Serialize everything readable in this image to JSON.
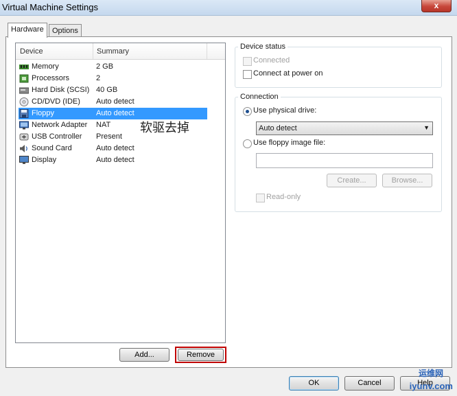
{
  "window": {
    "title": "Virtual Machine Settings",
    "close_glyph": "x"
  },
  "tabs": [
    {
      "label": "Hardware"
    },
    {
      "label": "Options"
    }
  ],
  "device_list": {
    "col_device": "Device",
    "col_summary": "Summary",
    "rows": [
      {
        "name": "Memory",
        "summary": "2 GB",
        "icon": "memory-icon"
      },
      {
        "name": "Processors",
        "summary": "2",
        "icon": "processor-icon"
      },
      {
        "name": "Hard Disk (SCSI)",
        "summary": "40 GB",
        "icon": "hard-disk-icon"
      },
      {
        "name": "CD/DVD (IDE)",
        "summary": "Auto detect",
        "icon": "cd-dvd-icon"
      },
      {
        "name": "Floppy",
        "summary": "Auto detect",
        "icon": "floppy-icon"
      },
      {
        "name": "Network Adapter",
        "summary": "NAT",
        "icon": "network-adapter-icon"
      },
      {
        "name": "USB Controller",
        "summary": "Present",
        "icon": "usb-icon"
      },
      {
        "name": "Sound Card",
        "summary": "Auto detect",
        "icon": "speaker-icon"
      },
      {
        "name": "Display",
        "summary": "Auto detect",
        "icon": "display-icon"
      }
    ],
    "selected_index": 4
  },
  "annotation": "软驱去掉",
  "buttons": {
    "add": "Add...",
    "remove": "Remove",
    "ok": "OK",
    "cancel": "Cancel",
    "help": "Help"
  },
  "device_status": {
    "title": "Device status",
    "connected": "Connected",
    "connect_at_power_on": "Connect at power on"
  },
  "connection": {
    "title": "Connection",
    "use_physical": "Use physical drive:",
    "physical_value": "Auto detect",
    "use_image": "Use floppy image file:",
    "image_value": "",
    "create": "Create...",
    "browse": "Browse...",
    "read_only": "Read-only"
  },
  "watermarks": {
    "corner_line1": "运维网",
    "corner_line2": "iyunv.com"
  },
  "colors": {
    "selection": "#3399ff",
    "highlight_border": "#c00000"
  }
}
